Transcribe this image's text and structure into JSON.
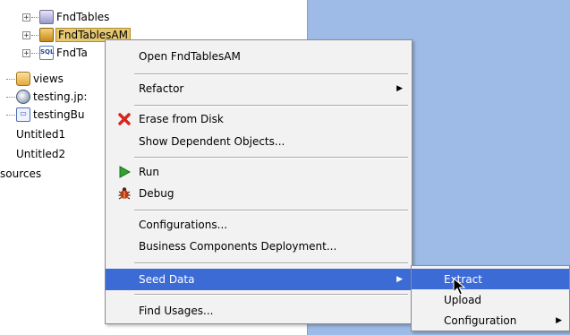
{
  "tree": {
    "items": [
      {
        "label": "FndTables",
        "icon": "tables-icon"
      },
      {
        "label": "FndTablesAM",
        "icon": "app-module-icon"
      },
      {
        "label": "FndTa",
        "icon": "sql-icon"
      },
      {
        "label": "views",
        "icon": "folder-icon"
      },
      {
        "label": "testing.jp:",
        "icon": "jsp-icon"
      },
      {
        "label": "testingBu",
        "icon": "bundle-icon"
      },
      {
        "label": "Untitled1"
      },
      {
        "label": "Untitled2"
      },
      {
        "label": "sources"
      }
    ]
  },
  "context_menu": {
    "items": [
      {
        "label": "Open FndTablesAM"
      },
      {
        "label": "Refactor"
      },
      {
        "label": "Erase from Disk",
        "icon": "red-x-icon"
      },
      {
        "label": "Show Dependent Objects..."
      },
      {
        "label": "Run",
        "icon": "run-icon"
      },
      {
        "label": "Debug",
        "icon": "debug-bug-icon"
      },
      {
        "label": "Configurations..."
      },
      {
        "label": "Business Components Deployment..."
      },
      {
        "label": "Seed Data"
      },
      {
        "label": "Find Usages..."
      }
    ]
  },
  "submenu": {
    "items": [
      {
        "label": "Extract"
      },
      {
        "label": "Upload"
      },
      {
        "label": "Configuration"
      }
    ]
  },
  "colors": {
    "selection": "#3d6bd6",
    "background_panel": "#9dbbe6",
    "menu_bg": "#f2f2f2"
  }
}
